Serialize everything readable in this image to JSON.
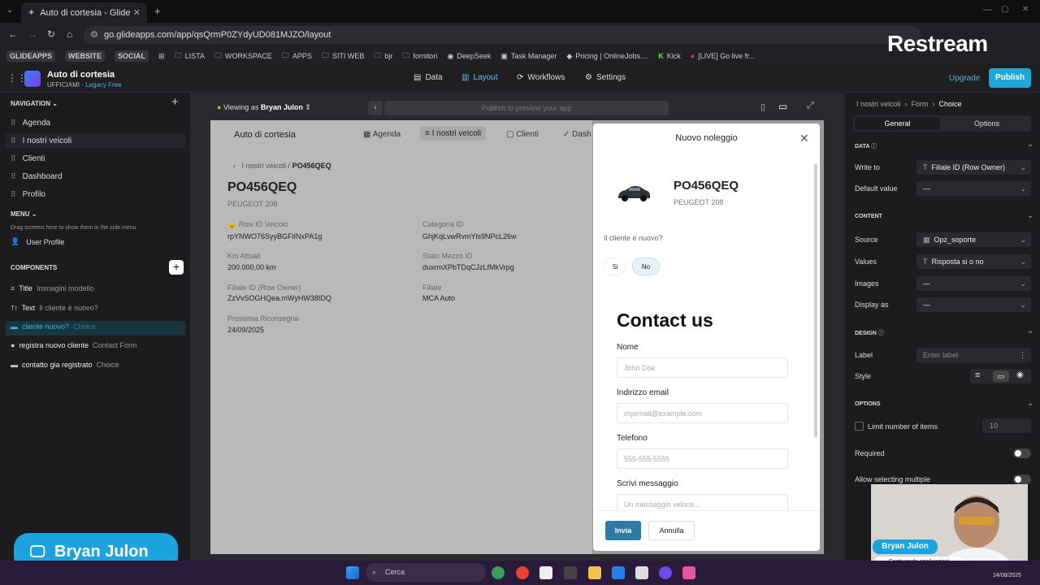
{
  "browser": {
    "tab_title": "Auto di cortesia - Glide",
    "url": "go.glideapps.com/app/qsQrmP0ZYdyUD081MJZO/layout",
    "bookmarks": [
      "GLIDEAPPS",
      "WEBSITE",
      "SOCIAL",
      "LISTA",
      "WORKSPACE",
      "APPS",
      "SITI WEB",
      "bjr",
      "fornitori",
      "DeepSeek",
      "Task Manager",
      "Pricing | OnlineJobs....",
      "Kick",
      "[LIVE] Go live fr..."
    ]
  },
  "header": {
    "app_name": "Auto di cortesia",
    "app_sub": "UFFICIAMI · ",
    "plan": "Legacy Free",
    "tabs": [
      "Data",
      "Layout",
      "Workflows",
      "Settings"
    ],
    "upgrade": "Upgrade",
    "publish": "Publish"
  },
  "sidebar": {
    "navigation_title": "NAVIGATION",
    "nav_items": [
      "Agenda",
      "I nostri veicoli",
      "Clienti",
      "Dashboard",
      "Profilo"
    ],
    "menu_title": "MENU",
    "menu_hint": "Drag screens here to show them in the side menu.",
    "menu_items": [
      "User Profile"
    ],
    "components_title": "COMPONENTS",
    "components": [
      {
        "name": "Title",
        "sub": "Immagini modello"
      },
      {
        "name": "Text",
        "sub": "Il cliente è nuovo?"
      },
      {
        "name": "cliente nuovo?",
        "sub": "Choice"
      },
      {
        "name": "registra nuovo cliente",
        "sub": "Contact Form"
      },
      {
        "name": "contatto gia registrato",
        "sub": "Choice"
      }
    ]
  },
  "canvas": {
    "viewing_prefix": "Viewing as ",
    "viewing_user": "Bryan Julon",
    "preview_text": "Publish to preview your app",
    "app_brand": "Auto di cortesia",
    "app_tabs": [
      "Agenda",
      "I nostri veicoli",
      "Clienti",
      "Dash"
    ],
    "breadcrumb_parent": "I nostri veicoli",
    "breadcrumb_current": "PO456QEQ",
    "title": "PO456QEQ",
    "subtitle": "PEUGEOT 208",
    "fields": [
      {
        "label": "Row ID Veicolo",
        "value": "rpYNWO76SyyBGFiINxPA1g"
      },
      {
        "label": "Categoria ID",
        "value": "GhjKqLvwRvmYls9NPcL26w"
      },
      {
        "label": "Km Attuali",
        "value": "200.000,00 km"
      },
      {
        "label": "Stato Mezzo ID",
        "value": "duxrmXPbTDqCJzLfMkVrpg"
      },
      {
        "label": "Filiale ID (Row Owner)",
        "value": "ZzVvSOGHQea.mWyHW38IDQ"
      },
      {
        "label": "Filiale",
        "value": "MCA Auto"
      },
      {
        "label": "Prossima Riconsegna",
        "value": "24/09/2025"
      }
    ]
  },
  "modal": {
    "title": "Nuovo noleggio",
    "plate": "PO456QEQ",
    "model": "PEUGEOT 208",
    "question": "Il cliente è nuovo?",
    "choice_yes": "Si",
    "choice_no": "No",
    "form_title": "Contact us",
    "fields": [
      {
        "label": "Nome",
        "placeholder": "John Doe"
      },
      {
        "label": "Indirizzo email",
        "placeholder": "myemail@example.com"
      },
      {
        "label": "Telefono",
        "placeholder": "555-555-5555"
      },
      {
        "label": "Scrivi messaggio",
        "placeholder": "Un messaggio veloce..."
      }
    ],
    "submit": "Invia",
    "cancel": "Annulla"
  },
  "right_panel": {
    "crumb": [
      "I nostri veicoli",
      "Form",
      "Choice"
    ],
    "tab_general": "General",
    "tab_options": "Options",
    "data_title": "DATA",
    "write_to_label": "Write to",
    "write_to_value": "Filiale ID (Row Owner)",
    "default_label": "Default value",
    "default_value": "—",
    "content_title": "CONTENT",
    "source_label": "Source",
    "source_value": "Opz_soporte",
    "values_label": "Values",
    "values_value": "Risposta si o no",
    "images_label": "Images",
    "images_value": "—",
    "display_label": "Display as",
    "display_value": "—",
    "design_title": "DESIGN",
    "label_label": "Label",
    "label_placeholder": "Enter label",
    "style_label": "Style",
    "options_title": "OPTIONS",
    "limit_label": "Limit number of items",
    "limit_value": "10",
    "required_label": "Required",
    "multiple_label": "Allow selecting multiple"
  },
  "overlay": {
    "restream": "Restream",
    "presenter": "Bryan Julon",
    "cam_name": "Bryan Julon",
    "cam_sub": "Costruendo applicazioni"
  },
  "taskbar": {
    "search": "Cerca",
    "date": "24/08/2025"
  },
  "colors": {
    "accent": "#1ea7d9",
    "layout_tab": "#6ab7f5",
    "selected_component": "#173640"
  }
}
